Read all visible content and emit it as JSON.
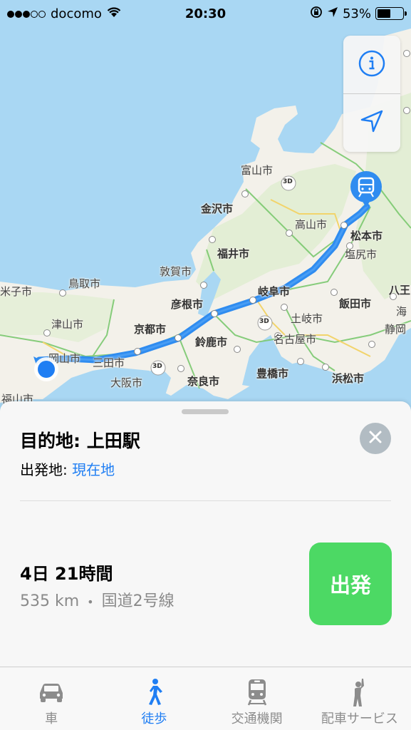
{
  "status_bar": {
    "carrier": "docomo",
    "time": "20:30",
    "battery": "53%",
    "battery_level": 0.53,
    "signal_bars_filled": 3,
    "signal_bars_total": 5
  },
  "map": {
    "cities": [
      {
        "id": "yonago",
        "label": "米子市",
        "bold": false
      },
      {
        "id": "tottori",
        "label": "鳥取市",
        "bold": false
      },
      {
        "id": "tsuyama",
        "label": "津山市",
        "bold": false
      },
      {
        "id": "okayama",
        "label": "岡山市",
        "bold": false
      },
      {
        "id": "sanda",
        "label": "三田市",
        "bold": false
      },
      {
        "id": "osaka",
        "label": "大阪市",
        "bold": false
      },
      {
        "id": "nara",
        "label": "奈良市",
        "bold": true
      },
      {
        "id": "kyoto",
        "label": "京都市",
        "bold": true
      },
      {
        "id": "suzuka",
        "label": "鈴鹿市",
        "bold": true
      },
      {
        "id": "hikone",
        "label": "彦根市",
        "bold": true
      },
      {
        "id": "tsuruga",
        "label": "敦賀市",
        "bold": false
      },
      {
        "id": "fukui",
        "label": "福井市",
        "bold": true
      },
      {
        "id": "kanazawa",
        "label": "金沢市",
        "bold": true
      },
      {
        "id": "toyama",
        "label": "富山市",
        "bold": false
      },
      {
        "id": "takayama",
        "label": "高山市",
        "bold": false
      },
      {
        "id": "gifu",
        "label": "岐阜市",
        "bold": true
      },
      {
        "id": "toki",
        "label": "土岐市",
        "bold": false
      },
      {
        "id": "nagoya",
        "label": "名古屋市",
        "bold": false
      },
      {
        "id": "toyohashi",
        "label": "豊橋市",
        "bold": true
      },
      {
        "id": "hamamatsu",
        "label": "浜松市",
        "bold": true
      },
      {
        "id": "iida",
        "label": "飯田市",
        "bold": true
      },
      {
        "id": "shiojiri",
        "label": "塩尻市",
        "bold": false
      },
      {
        "id": "matsumoto",
        "label": "松本市",
        "bold": true
      },
      {
        "id": "fukuyama",
        "label": "福山市",
        "bold": false
      },
      {
        "id": "hachioji",
        "label": "八王",
        "bold": true
      },
      {
        "id": "umi",
        "label": "海",
        "bold": false
      },
      {
        "id": "shizuoka",
        "label": "静岡",
        "bold": false
      }
    ],
    "road_badge": "3D",
    "accent_color": "#1f7ef3",
    "route_color": "#2f8cf0"
  },
  "map_controls": {
    "info_icon": "info-icon",
    "location_icon": "location-arrow-icon"
  },
  "card": {
    "destination_label": "目的地: 上田駅",
    "origin_prefix": "出発地: ",
    "origin_value": "現在地",
    "duration": "4日 21時間",
    "distance": "535 km",
    "separator": "•",
    "route_name": "国道2号線",
    "go_label": "出発",
    "go_color": "#4cd964"
  },
  "tabbar": {
    "tabs": [
      {
        "label": "車",
        "icon": "car-icon",
        "active": false
      },
      {
        "label": "徒歩",
        "icon": "walk-icon",
        "active": true
      },
      {
        "label": "交通機関",
        "icon": "train-icon",
        "active": false
      },
      {
        "label": "配車サービス",
        "icon": "ride-hail-icon",
        "active": false
      }
    ]
  }
}
